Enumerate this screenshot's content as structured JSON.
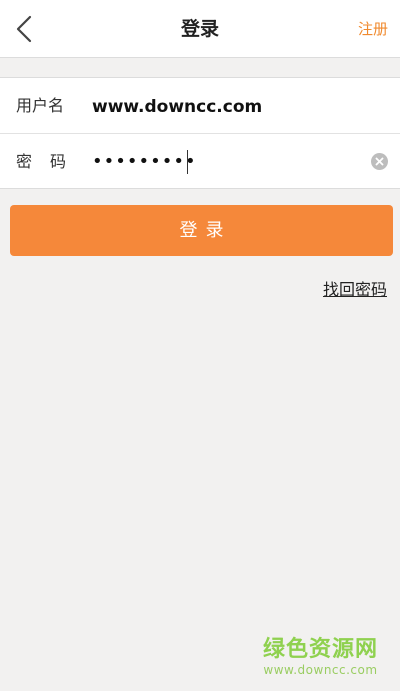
{
  "header": {
    "title": "登录",
    "register_label": "注册"
  },
  "form": {
    "username_label": "用户名",
    "username_value": "www.downcc.com",
    "password_label": "密码",
    "password_value": "•••••••••"
  },
  "login_button_label": "登录",
  "find_password_label": "找回密码",
  "watermark": {
    "brand": "绿色资源网",
    "url": "www.downcc.com"
  },
  "colors": {
    "accent": "#f5883a",
    "register_text": "#f08a2e",
    "background": "#f2f1f0",
    "watermark": "#8fd14f"
  },
  "icons": {
    "back": "chevron-left-icon",
    "clear": "clear-circle-x-icon"
  }
}
